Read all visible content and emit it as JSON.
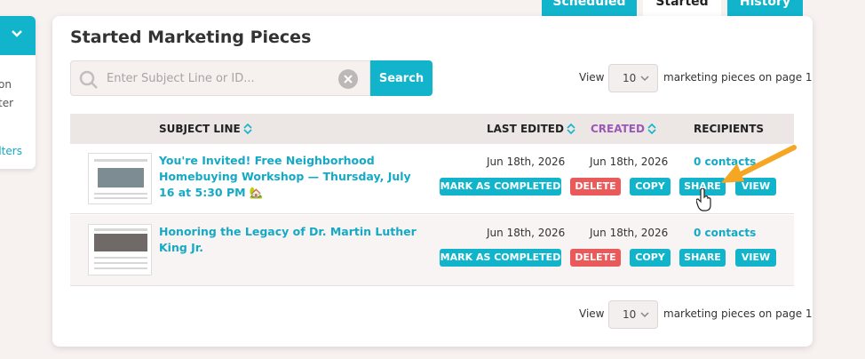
{
  "left_panel": {
    "line1": "on",
    "line2": "ter",
    "filters_link": "ilters"
  },
  "tabs": [
    {
      "label": "Scheduled"
    },
    {
      "label": "Started"
    },
    {
      "label": "History"
    }
  ],
  "card": {
    "title": "Started Marketing Pieces"
  },
  "search": {
    "placeholder": "Enter Subject Line or ID...",
    "value": "",
    "button_label": "Search"
  },
  "pagination": {
    "view_label": "View",
    "page_size": "10",
    "suffix": "marketing pieces on page 1"
  },
  "table": {
    "headers": {
      "subject": "SUBJECT LINE",
      "last_edited": "LAST EDITED",
      "created": "CREATED",
      "recipients": "RECIPIENTS"
    },
    "rows": [
      {
        "subject": "You're Invited! Free Neighborhood Homebuying Workshop — Thursday, July 16 at 5:30 PM 🏡",
        "last_edited": "Jun 18th, 2026",
        "created": "Jun 18th, 2026",
        "recipients": "0 contacts"
      },
      {
        "subject": "Honoring the Legacy of Dr. Martin Luther King Jr.",
        "last_edited": "Jun 18th, 2026",
        "created": "Jun 18th, 2026",
        "recipients": "0 contacts"
      }
    ],
    "actions": {
      "mark_completed": "MARK AS COMPLETED",
      "delete": "DELETE",
      "copy": "COPY",
      "share": "SHARE",
      "view": "VIEW"
    }
  },
  "colors": {
    "accent": "#12b4cc",
    "delete": "#ea5a5a",
    "created_header": "#9b59b6",
    "arrow": "#f5a623"
  }
}
